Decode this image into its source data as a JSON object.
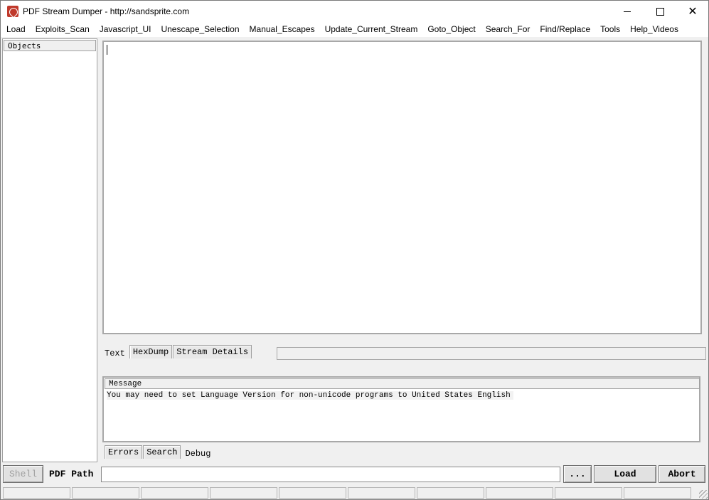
{
  "window": {
    "title": "PDF Stream Dumper - http://sandsprite.com",
    "controls": {
      "minimize": "—",
      "maximize": "☐",
      "close": "✕"
    }
  },
  "menu": [
    "Load",
    "Exploits_Scan",
    "Javascript_UI",
    "Unescape_Selection",
    "Manual_Escapes",
    "Update_Current_Stream",
    "Goto_Object",
    "Search_For",
    "Find/Replace",
    "Tools",
    "Help_Videos"
  ],
  "objects_panel": {
    "header": "Objects"
  },
  "editor": {
    "text": ""
  },
  "view_tabs": [
    "Text",
    "HexDump",
    "Stream Details"
  ],
  "view_tabs_active": "Text",
  "message_panel": {
    "header": "Message",
    "rows": [
      "You may need to set Language Version for non-unicode programs to United States English"
    ]
  },
  "log_tabs": [
    "Errors",
    "Search",
    "Debug"
  ],
  "log_tabs_active": "Debug",
  "bottom": {
    "shell_label": "Shell",
    "path_label": "PDF Path",
    "path_value": "",
    "browse_label": "...",
    "load_label": "Load",
    "abort_label": "Abort"
  },
  "status_panels": [
    "",
    "",
    "",
    "",
    "",
    "",
    "",
    "",
    "",
    ""
  ],
  "colors": {
    "accent_icon": "#c0392b",
    "window_bg": "#f0f0f0"
  }
}
